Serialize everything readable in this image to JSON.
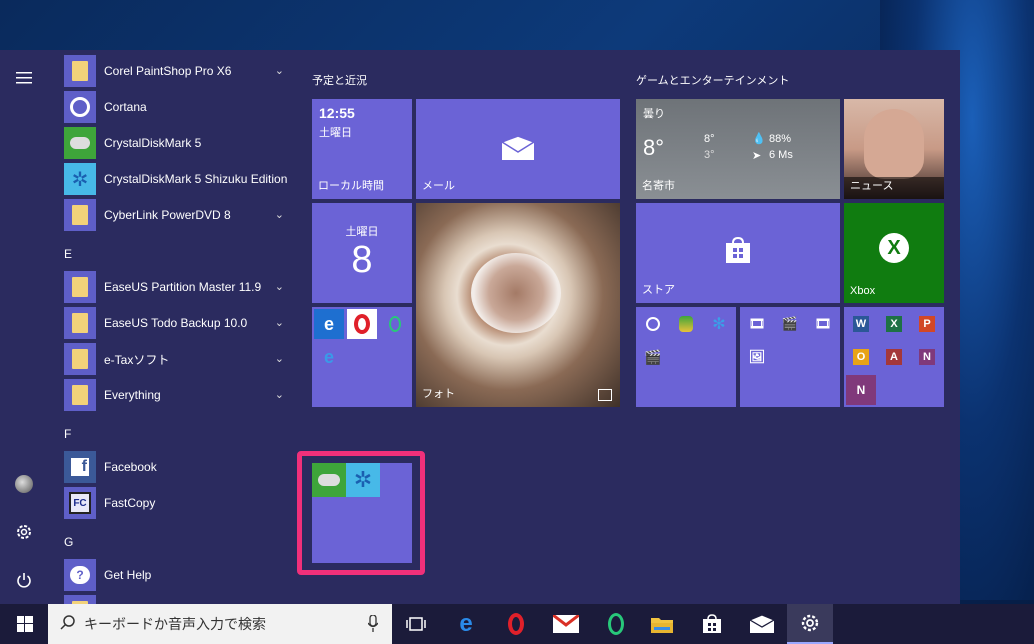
{
  "rail": {
    "menu_icon": "hamburger-icon",
    "user_icon": "user-avatar",
    "settings_icon": "gear-icon",
    "power_icon": "power-icon"
  },
  "app_list": {
    "items": [
      {
        "label": "Corel PaintShop Pro X6",
        "icon": "folder-icon",
        "expandable": true
      },
      {
        "label": "Cortana",
        "icon": "cortana-icon",
        "expandable": false
      },
      {
        "label": "CrystalDiskMark 5",
        "icon": "crystaldiskmark-icon",
        "expandable": false
      },
      {
        "label": "CrystalDiskMark 5 Shizuku Edition",
        "icon": "crystaldiskmark-shizuku-icon",
        "expandable": false
      },
      {
        "label": "CyberLink PowerDVD 8",
        "icon": "folder-icon",
        "expandable": true
      },
      {
        "label": "EaseUS Partition Master 11.9",
        "icon": "folder-icon",
        "expandable": true
      },
      {
        "label": "EaseUS Todo Backup 10.0",
        "icon": "folder-icon",
        "expandable": true
      },
      {
        "label": "e-Taxソフト",
        "icon": "folder-icon",
        "expandable": true
      },
      {
        "label": "Everything",
        "icon": "folder-icon",
        "expandable": true
      },
      {
        "label": "Facebook",
        "icon": "facebook-icon",
        "expandable": false
      },
      {
        "label": "FastCopy",
        "icon": "fastcopy-icon",
        "expandable": false
      },
      {
        "label": "Get Help",
        "icon": "get-help-icon",
        "expandable": false
      }
    ],
    "letters": [
      "E",
      "F",
      "G"
    ]
  },
  "groups": {
    "left_title": "予定と近況",
    "right_title": "ゲームとエンターテインメント"
  },
  "tiles": {
    "clock": {
      "time": "12:55",
      "day": "土曜日",
      "label": "ローカル時間"
    },
    "mail": {
      "label": "メール"
    },
    "calendar": {
      "day": "土曜日",
      "date": "8"
    },
    "photo": {
      "label": "フォト"
    },
    "weather": {
      "condition": "曇り",
      "temp": "8°",
      "high": "8°",
      "low": "3°",
      "humidity": "88%",
      "wind": "6 Ms",
      "city": "名寄市"
    },
    "news": {
      "label": "ニュース"
    },
    "store": {
      "label": "ストア"
    },
    "xbox": {
      "label": "Xbox"
    }
  },
  "taskbar": {
    "search_placeholder": "キーボードか音声入力で検索"
  },
  "colors": {
    "tile": "#6b63d6",
    "highlight": "#f0307a",
    "xbox": "#107c10"
  }
}
